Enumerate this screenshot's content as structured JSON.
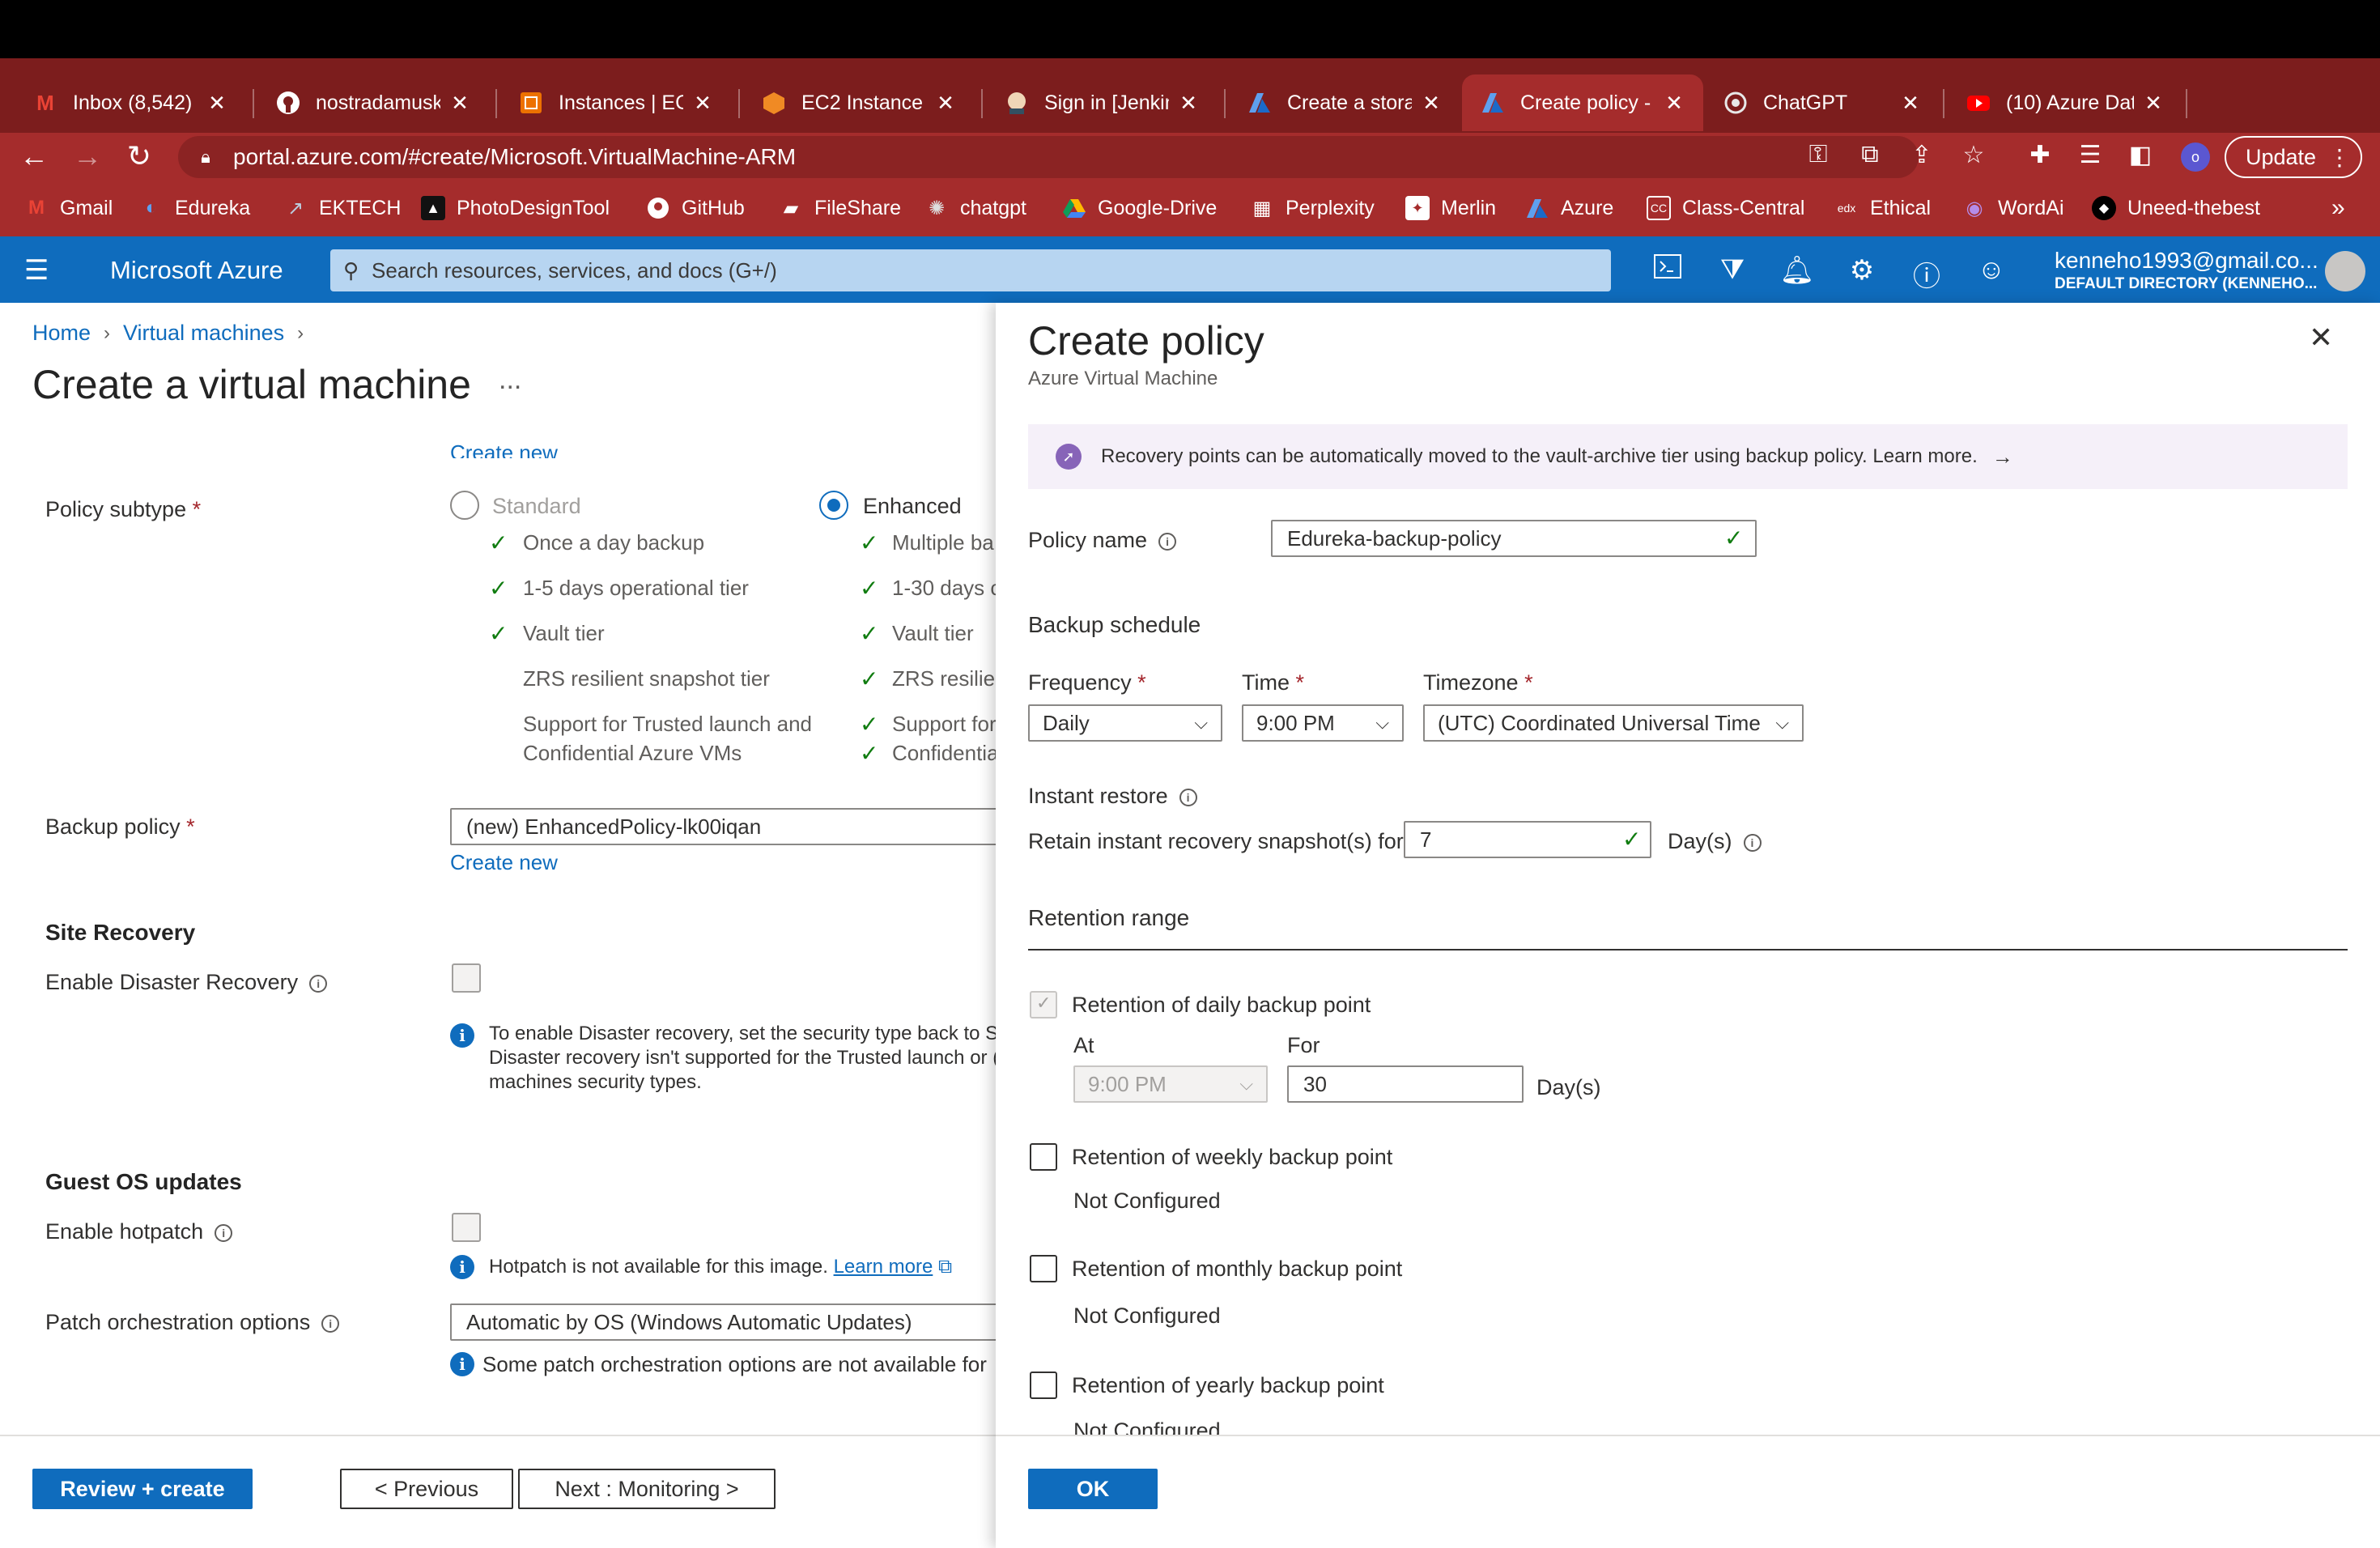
{
  "browser": {
    "tabs": [
      {
        "title": "Inbox (8,542) -",
        "icon": "gmail-icon",
        "active": false
      },
      {
        "title": "nostradamusk",
        "icon": "github-icon",
        "active": false
      },
      {
        "title": "Instances | EC2",
        "icon": "aws-ec2-icon",
        "active": false
      },
      {
        "title": "EC2 Instance C",
        "icon": "aws-cube-icon",
        "active": false
      },
      {
        "title": "Sign in [Jenkin",
        "icon": "jenkins-icon",
        "active": false
      },
      {
        "title": "Create a storag",
        "icon": "azure-icon",
        "active": false
      },
      {
        "title": "Create policy -",
        "icon": "azure-icon",
        "active": true
      },
      {
        "title": "ChatGPT",
        "icon": "chatgpt-icon",
        "active": false
      },
      {
        "title": "(10) Azure Dat",
        "icon": "youtube-icon",
        "active": false
      }
    ],
    "url": "portal.azure.com/#create/Microsoft.VirtualMachine-ARM",
    "profile_initial": "o",
    "update_label": "Update",
    "bookmarks": [
      "Gmail",
      "Edureka",
      "EKTECH",
      "PhotoDesignTool",
      "GitHub",
      "FileShare",
      "chatgpt",
      "Google-Drive",
      "Perplexity",
      "Merlin",
      "Azure",
      "Class-Central",
      "Ethical",
      "WordAi",
      "Uneed-thebest"
    ],
    "bookmarks_more": "»"
  },
  "azure_header": {
    "brand": "Microsoft Azure",
    "search_placeholder": "Search resources, services, and docs (G+/)",
    "account_email": "kenneho1993@gmail.co...",
    "account_directory": "DEFAULT DIRECTORY (KENNEHO..."
  },
  "page": {
    "breadcrumb": [
      "Home",
      "Virtual machines"
    ],
    "title": "Create a virtual machine",
    "title_more": "...",
    "create_new_top": "Create new",
    "policy_subtype_label": "Policy subtype",
    "standard": {
      "label": "Standard",
      "features": [
        "Once a day backup",
        "1-5 days operational tier",
        "Vault tier",
        "ZRS resilient snapshot tier",
        "Support for Trusted launch and",
        "Confidential Azure VMs"
      ]
    },
    "enhanced": {
      "label": "Enhanced",
      "features": [
        "Multiple ba",
        "1-30 days c",
        "Vault tier",
        "ZRS resilien",
        "Support for",
        "Confidentia"
      ]
    },
    "backup_policy_label": "Backup policy",
    "backup_policy_value": "(new) EnhancedPolicy-lk00iqan",
    "create_new": "Create new",
    "site_recovery_header": "Site Recovery",
    "enable_dr_label": "Enable Disaster Recovery",
    "dr_note": [
      "To enable Disaster recovery, set the security type back to St",
      "Disaster recovery isn't supported for the Trusted launch or (",
      "machines security types."
    ],
    "guest_os_header": "Guest OS updates",
    "enable_hotpatch_label": "Enable hotpatch",
    "hotpatch_note": "Hotpatch is not available for this image.",
    "learn_more": "Learn more",
    "patch_label": "Patch orchestration options",
    "patch_value": "Automatic by OS (Windows Automatic Updates)",
    "patch_note": "Some patch orchestration options are not available for",
    "buttons": {
      "review": "Review + create",
      "previous": "< Previous",
      "next": "Next : Monitoring >"
    }
  },
  "panel": {
    "title": "Create policy",
    "subtitle": "Azure Virtual Machine",
    "banner": "Recovery points can be automatically moved to the vault-archive tier using backup policy. Learn more.",
    "policy_name_label": "Policy name",
    "policy_name_value": "Edureka-backup-policy",
    "backup_schedule": "Backup schedule",
    "frequency_label": "Frequency",
    "frequency_value": "Daily",
    "time_label": "Time",
    "time_value": "9:00 PM",
    "timezone_label": "Timezone",
    "timezone_value": "(UTC) Coordinated Universal Time",
    "instant_restore": "Instant restore",
    "retain_label": "Retain instant recovery snapshot(s) for",
    "retain_value": "7",
    "days_unit": "Day(s)",
    "retention_range": "Retention range",
    "daily_label": "Retention of daily backup point",
    "at_label": "At",
    "at_value": "9:00 PM",
    "for_label": "For",
    "for_value": "30",
    "weekly_label": "Retention of weekly backup point",
    "monthly_label": "Retention of monthly backup point",
    "yearly_label": "Retention of yearly backup point",
    "not_configured": "Not Configured",
    "ok": "OK"
  },
  "colors": {
    "azure_blue": "#0f6cbd",
    "tab_strip": "#7c1d1d",
    "toolbar": "#a52c2c",
    "success_green": "#107c10",
    "required_red": "#a4262c"
  }
}
